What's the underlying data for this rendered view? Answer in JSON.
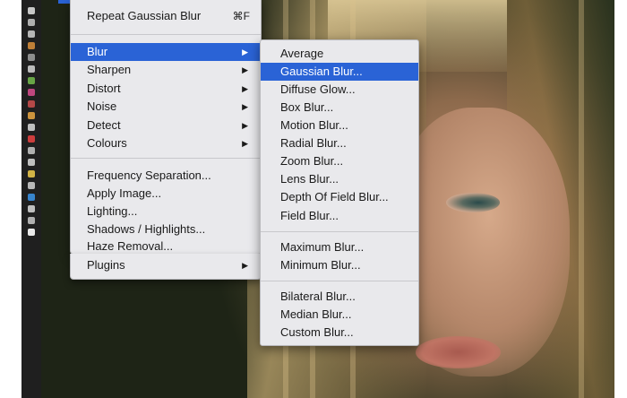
{
  "main_menu": {
    "repeat_item": {
      "label": "Repeat Gaussian Blur",
      "shortcut": "⌘F"
    },
    "filter_groups": [
      {
        "label": "Blur",
        "has_submenu": true,
        "highlighted": true
      },
      {
        "label": "Sharpen",
        "has_submenu": true
      },
      {
        "label": "Distort",
        "has_submenu": true
      },
      {
        "label": "Noise",
        "has_submenu": true
      },
      {
        "label": "Detect",
        "has_submenu": true
      },
      {
        "label": "Colours",
        "has_submenu": true
      }
    ],
    "other_items": [
      {
        "label": "Frequency Separation..."
      },
      {
        "label": "Apply Image..."
      },
      {
        "label": "Lighting..."
      },
      {
        "label": "Shadows / Highlights..."
      },
      {
        "label": "Haze Removal..."
      },
      {
        "label": "Plugins",
        "has_submenu": true
      }
    ]
  },
  "blur_submenu": {
    "group1": [
      "Average",
      "Gaussian Blur...",
      "Diffuse Glow...",
      "Box Blur...",
      "Motion Blur...",
      "Radial Blur...",
      "Zoom Blur...",
      "Lens Blur...",
      "Depth Of Field Blur...",
      "Field Blur..."
    ],
    "group2": [
      "Maximum Blur...",
      "Minimum Blur..."
    ],
    "group3": [
      "Bilateral Blur...",
      "Median Blur...",
      "Custom Blur..."
    ],
    "highlighted": "Gaussian Blur..."
  },
  "toolbar": {
    "tools": [
      "move-tool-icon",
      "select-tool-icon",
      "crop-tool-icon",
      "brush-tool-icon",
      "eraser-tool-icon",
      "fill-tool-icon",
      "gradient-tool-icon",
      "pen-tool-icon",
      "text-tool-icon",
      "shape-tool-icon",
      "zoom-tool-icon"
    ]
  },
  "colors": {
    "highlight": "#2a63d6",
    "menu_bg": "#e9e9ec",
    "toolbar_bg": "#1f1f1f"
  }
}
